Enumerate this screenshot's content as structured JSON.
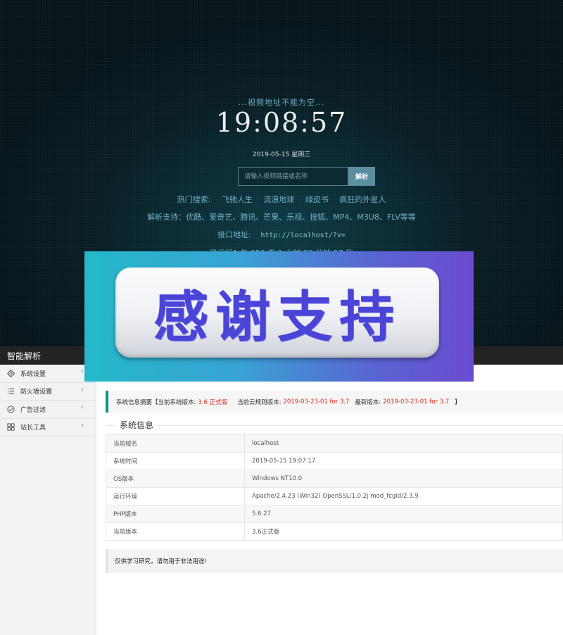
{
  "hero": {
    "empty_hint": "...视频地址不能为空...",
    "clock": "19:08:57",
    "date": "2019-05-15 星期三",
    "search_placeholder": "请输入视频链接或名称",
    "parse_button": "解析",
    "hot_label": "热门搜索:",
    "hot_items": [
      "飞驰人生",
      "流浪地球",
      "绿皮书",
      "疯狂的外星人"
    ],
    "support_text": "解析支持：优酷、爱奇艺、腾讯、芒果、乐视、搜狐、MP4、M3U8、FLV等等",
    "api_label": "接口地址:",
    "api_url": "http://localhost/?v=",
    "uptime": "已运行1 年 359 天 1 小时 29 分钟 57 秒"
  },
  "banner": {
    "text": "感谢支持"
  },
  "app": {
    "title": "智能解析",
    "sidebar": [
      {
        "label": "系统设置",
        "icon": "gear-icon"
      },
      {
        "label": "防火墙设置",
        "icon": "list-icon"
      },
      {
        "label": "广告过滤",
        "icon": "check-circle-icon"
      },
      {
        "label": "站长工具",
        "icon": "grid-icon"
      }
    ],
    "summary": {
      "prefix": "系统信息摘要【当前系统版本:",
      "current_version": "3.6 正式版",
      "cloud_label": "当前云规则版本:",
      "cloud_version": "2019-03-23-01 for 3.7",
      "latest_label": "最新版本:",
      "latest_version": "2019-03-23-01 for 3.7",
      "suffix": "】"
    },
    "section_title": "系统信息",
    "info_rows": [
      {
        "key": "当前域名",
        "value": "localhost"
      },
      {
        "key": "系统时间",
        "value": "2019-05-15 19:07:17"
      },
      {
        "key": "OS版本",
        "value": "Windows NT10.0"
      },
      {
        "key": "运行环境",
        "value": "Apache/2.4.23 (Win32) OpenSSL/1.0.2j mod_fcgid/2.3.9"
      },
      {
        "key": "PHP版本",
        "value": "5.6.27"
      },
      {
        "key": "当前版本",
        "value": "3.6正式版"
      }
    ],
    "notice": "仅供学习研究，请勿用于非法用途!"
  },
  "colors": {
    "accent": "#009688",
    "highlight_red": "#d9261c",
    "banner_text": "#4a45d6"
  }
}
